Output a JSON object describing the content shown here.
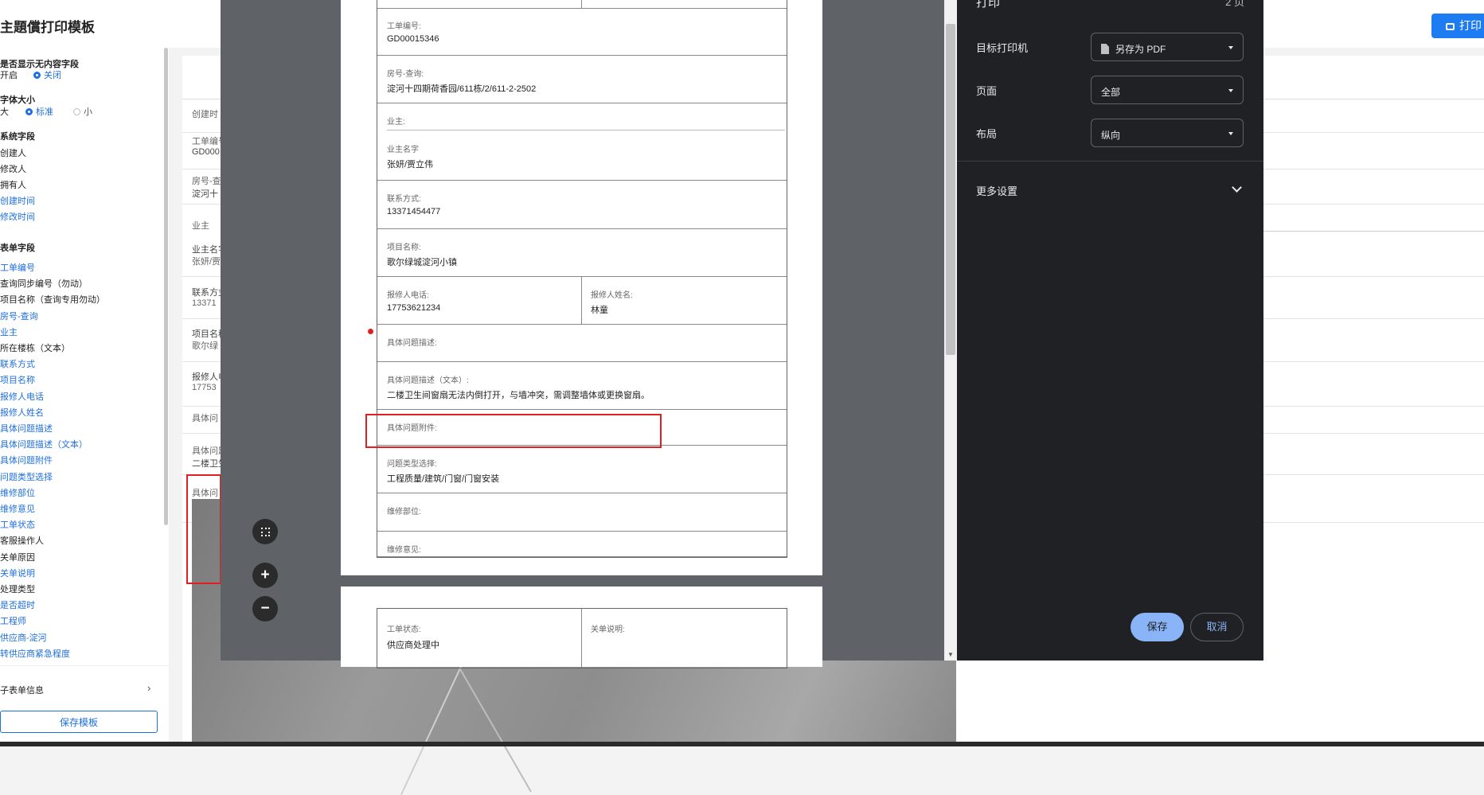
{
  "background_app": {
    "title": "主題償打印模板",
    "print_button": "打印",
    "sidebar": {
      "empty_field_section": "是否显示无内容字段",
      "empty_on": "开启",
      "empty_off": "关闭",
      "font_size_section": "字体大小",
      "size_large": "大",
      "size_standard": "标准",
      "size_small": "小",
      "system_fields_title": "系统字段",
      "system_fields": [
        "创建人",
        "修改人",
        "拥有人",
        "创建时间",
        "修改时间"
      ],
      "form_fields_title": "表单字段",
      "form_fields": [
        "工单编号",
        "查询同步编号（勿动）",
        "项目名称（查询专用勿动）",
        "房号-查询",
        "业主",
        "所在楼栋（文本）",
        "联系方式",
        "项目名称",
        "报修人电话",
        "报修人姓名",
        "具体问题描述",
        "具体问题描述（文本）",
        "具体问题附件",
        "问题类型选择",
        "维修部位",
        "维修意见",
        "工单状态",
        "客服操作人",
        "关单原因",
        "关单说明",
        "处理类型",
        "是否超时",
        "工程师",
        "供应商-淀河",
        "转供应商紧急程度"
      ],
      "sub_form": "子表单信息",
      "save_template": "保存模板"
    },
    "table_snippets": [
      "创建时",
      "工单编号",
      "GD000",
      "房号-查",
      "淀河十",
      "业主",
      "业主名字",
      "张妍/贾",
      "联系方式",
      "13371",
      "项目名称",
      "歌尔绿",
      "报修人电",
      "17753",
      "具体问",
      "具体问题",
      "二楼卫生",
      "具体问"
    ]
  },
  "preview": {
    "page1": {
      "rows": [
        {
          "label": "工单编号:",
          "value": "GD00015346"
        },
        {
          "label": "房号-查询:",
          "value": "淀河十四期荷香园/611栋/2/611-2-2502"
        },
        {
          "label": "业主:",
          "sublabel": "业主名字",
          "value": "张妍/贾立伟"
        },
        {
          "label": "联系方式:",
          "value": "13371454477"
        },
        {
          "label": "项目名称:",
          "value": "歌尔绿城淀河小镇"
        },
        {
          "label": "报修人电话:",
          "value": "17753621234",
          "label2": "报修人姓名:",
          "value2": "林童"
        },
        {
          "label": "具体问题描述:",
          "value": ""
        },
        {
          "label": "具体问题描述（文本）:",
          "value": "二楼卫生间窗扇无法内倒打开，与墙冲突，需调整墙体或更换窗扇。"
        },
        {
          "label": "具体问题附件:",
          "value": ""
        },
        {
          "label": "问题类型选择:",
          "value": "工程质量/建筑/门窗/门窗安装"
        },
        {
          "label": "维修部位:",
          "value": ""
        },
        {
          "label": "维修意见:",
          "value": ""
        }
      ]
    },
    "page2": {
      "label": "工单状态:",
      "value": "供应商处理中",
      "label2": "关单说明:"
    },
    "zoom_fit": "fit-to-page",
    "zoom_in": "+",
    "zoom_out": "−"
  },
  "print_settings": {
    "title": "打印",
    "page_count": "2 页",
    "destination_label": "目标打印机",
    "destination_value": "另存为 PDF",
    "pages_label": "页面",
    "pages_value": "全部",
    "layout_label": "布局",
    "layout_value": "纵向",
    "more_settings": "更多设置",
    "save": "保存",
    "cancel": "取消"
  }
}
